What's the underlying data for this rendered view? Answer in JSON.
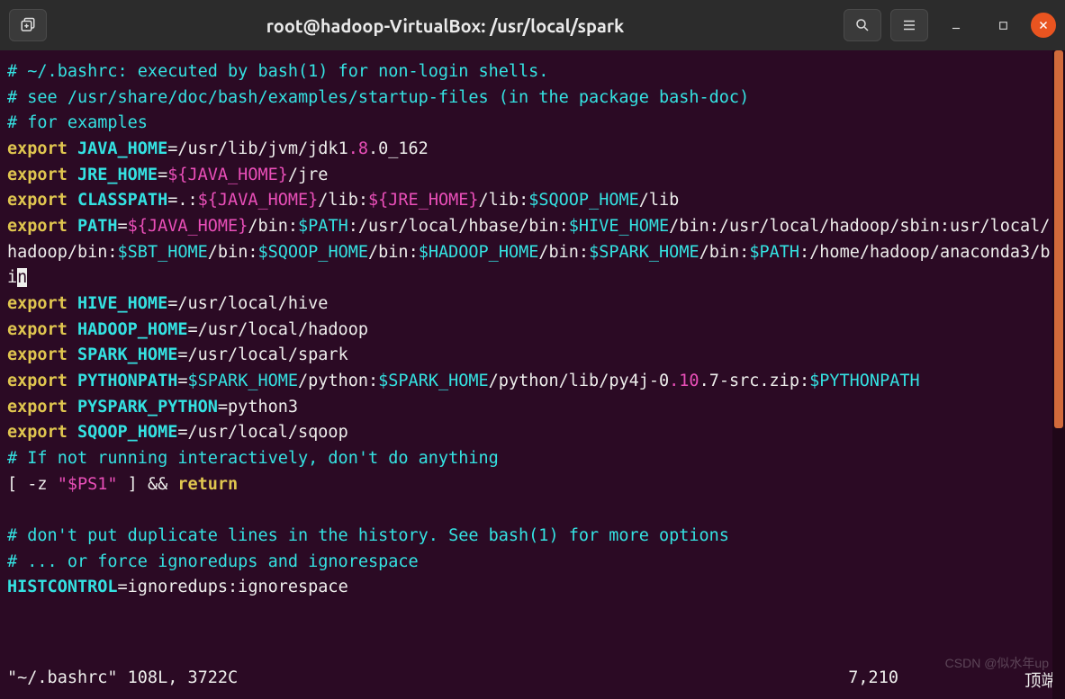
{
  "titlebar": {
    "title": "root@hadoop-VirtualBox: /usr/local/spark",
    "new_tab_icon": "⎘",
    "search_icon": "search",
    "menu_icon": "≡",
    "minimize_icon": "—",
    "maximize_icon": "□",
    "close_icon": "×"
  },
  "code": {
    "l1": "# ~/.bashrc: executed by bash(1) for non-login shells.",
    "l2": "# see /usr/share/doc/bash/examples/startup-files (in the package bash-doc)",
    "l3": "# for examples",
    "l4_kw": "export",
    "l4_var": " JAVA_HOME",
    "l4_eq": "=/usr/lib/jvm/jdk1",
    "l4_n1": ".8",
    "l4_rest": ".0_162",
    "l5_kw": "export",
    "l5_var": " JRE_HOME",
    "l5_eq": "=",
    "l5_sub": "${JAVA_HOME}",
    "l5_rest": "/jre",
    "l6_kw": "export",
    "l6_var": " CLASSPATH",
    "l6_eq": "=.:",
    "l6_s1": "${JAVA_HOME}",
    "l6_t1": "/lib:",
    "l6_s2": "${JRE_HOME}",
    "l6_t2": "/lib:",
    "l6_s3": "$SQOOP_HOME",
    "l6_t3": "/lib",
    "l7_kw": "export",
    "l7_var": " PATH",
    "l7_eq": "=",
    "l7_s1": "${JAVA_HOME}",
    "l7_t1": "/bin:",
    "l7_s2": "$PATH",
    "l7_t2": ":/usr/local/hbase/bin:",
    "l7_s3": "$HIVE_HOME",
    "l7_t3": "/bin:/usr/local/hadoop/sbin:usr/local/hadoop/bin:",
    "l7_s4": "$SBT_HOME",
    "l7_t4": "/bin:",
    "l7_s5": "$SQOOP_HOME",
    "l7_t5": "/bin:",
    "l7_s6": "$HADOOP_HOME",
    "l7_t6": "/bin:",
    "l7_s7": "$SPARK_HOME",
    "l7_t7": "/bin:",
    "l7_s8": "$PATH",
    "l7_t8": ":/home/hadoop/anaconda3/bi",
    "l7_cur": "n",
    "l8_kw": "export",
    "l8_var": " HIVE_HOME",
    "l8_rest": "=/usr/local/hive",
    "l9_kw": "export",
    "l9_var": " HADOOP_HOME",
    "l9_rest": "=/usr/local/hadoop",
    "l10_kw": "export",
    "l10_var": " SPARK_HOME",
    "l10_rest": "=/usr/local/spark",
    "l11_kw": "export",
    "l11_var": " PYTHONPATH",
    "l11_eq": "=",
    "l11_s1": "$SPARK_HOME",
    "l11_t1": "/python:",
    "l11_s2": "$SPARK_HOME",
    "l11_t2": "/python/lib/py4j-0",
    "l11_n1": ".10",
    "l11_t3": ".7-src.zip:",
    "l11_s3": "$PYTHONPATH",
    "l12_kw": "export",
    "l12_var": " PYSPARK_PYTHON",
    "l12_rest": "=python3",
    "l13_kw": "export",
    "l13_var": " SQOOP_HOME",
    "l13_rest": "=/usr/local/sqoop",
    "l14": "# If not running interactively, don't do anything",
    "l15_a": "[ -z ",
    "l15_b": "\"$PS1\"",
    "l15_c": " ] && ",
    "l15_d": "return",
    "l16": "# don't put duplicate lines in the history. See bash(1) for more options",
    "l17": "# ... or force ignoredups and ignorespace",
    "l18_var": "HISTCONTROL",
    "l18_rest": "=ignoredups:ignorespace"
  },
  "status": {
    "file": "\"~/.bashrc\" 108L, 3722C",
    "pos": "7,210",
    "top": "顶端"
  },
  "watermark": "CSDN @似水年up"
}
